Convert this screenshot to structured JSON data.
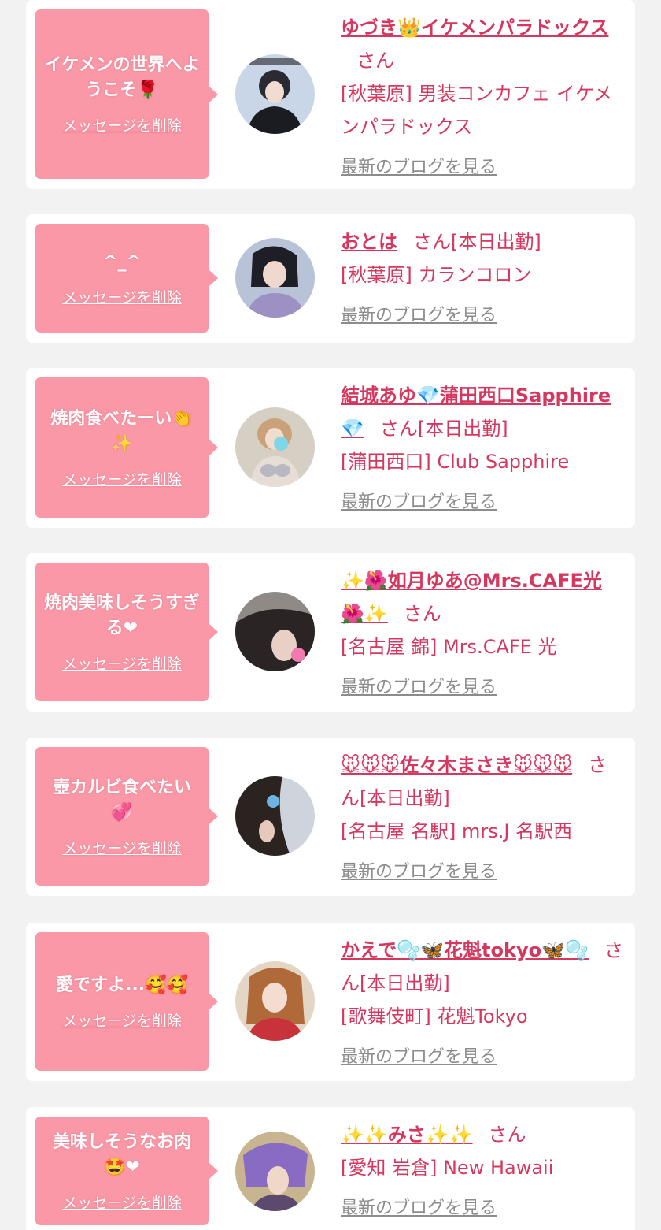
{
  "cards": [
    {
      "message": "イケメンの世界へようこそ🌹",
      "delete_label": "メッセージを削除",
      "name": "ゆづき👑イケメンパラドックス",
      "suffix": "さん",
      "shop": "[秋葉原] 男装コンカフェ イケメンパラドックス",
      "blog_label": "最新のブログを見る"
    },
    {
      "message": "^_^",
      "delete_label": "メッセージを削除",
      "name": "おとは",
      "suffix": "さん[本日出勤]",
      "shop": "[秋葉原] カランコロン",
      "blog_label": "最新のブログを見る"
    },
    {
      "message": "焼肉食べたーい👏✨",
      "delete_label": "メッセージを削除",
      "name": "結城あゆ💎蒲田西口Sapphire💎",
      "suffix": "さん[本日出勤]",
      "shop": "[蒲田西口] Club Sapphire",
      "blog_label": "最新のブログを見る"
    },
    {
      "message": "焼肉美味しそうすぎる❤",
      "delete_label": "メッセージを削除",
      "name": "✨🌺如月ゆあ@Mrs.CAFE光🌺✨",
      "suffix": "さん",
      "shop": "[名古屋 錦] Mrs.CAFE 光",
      "blog_label": "最新のブログを見る"
    },
    {
      "message": "壺カルビ食べたい💞",
      "delete_label": "メッセージを削除",
      "name": "🐭🐭🐭佐々木まさき🐭🐭🐭",
      "suffix": "さん[本日出勤]",
      "shop": "[名古屋 名駅] mrs.J 名駅西",
      "blog_label": "最新のブログを見る"
    },
    {
      "message": "愛ですよ...🥰🥰",
      "delete_label": "メッセージを削除",
      "name": "かえで🫧🦋花魁tokyo🦋🫧",
      "suffix": "さん[本日出勤]",
      "shop": "[歌舞伎町] 花魁Tokyo",
      "blog_label": "最新のブログを見る"
    },
    {
      "message": "美味しそうなお肉🤩❤",
      "delete_label": "メッセージを削除",
      "name": "✨✨みさ✨✨",
      "suffix": "さん",
      "shop": "[愛知 岩倉] New Hawaii",
      "blog_label": "最新のブログを見る"
    }
  ],
  "colors": {
    "bubble": "#fa98a7",
    "accent": "#d6375e",
    "link_gray": "#8c8c8c",
    "background": "#f2f2f2"
  }
}
